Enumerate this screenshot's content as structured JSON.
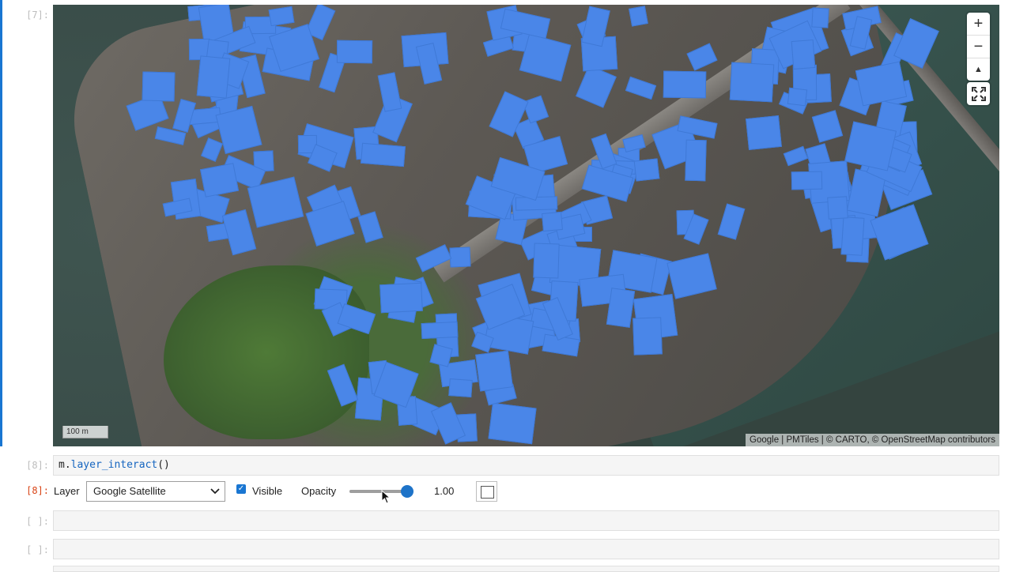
{
  "cells": {
    "map_prompt": "[7]:",
    "code_prompt": "[8]:",
    "code_object": "m.",
    "code_method": "layer_interact",
    "code_suffix": "()",
    "output_prompt": "[8]:",
    "empty_prompt_1": "[ ]:",
    "empty_prompt_2": "[ ]:"
  },
  "map": {
    "zoom_in": "+",
    "zoom_out": "−",
    "reset_north": "▲",
    "scale_label": "100 m",
    "attribution": "Google | PMTiles | © CARTO, © OpenStreetMap contributors",
    "building_color": "#4a86e8"
  },
  "widget": {
    "layer_label": "Layer",
    "layer_value": "Google Satellite",
    "visible_label": "Visible",
    "visible_checked": true,
    "opacity_label": "Opacity",
    "opacity_value": "1.00",
    "opacity_fraction": 1.0
  }
}
